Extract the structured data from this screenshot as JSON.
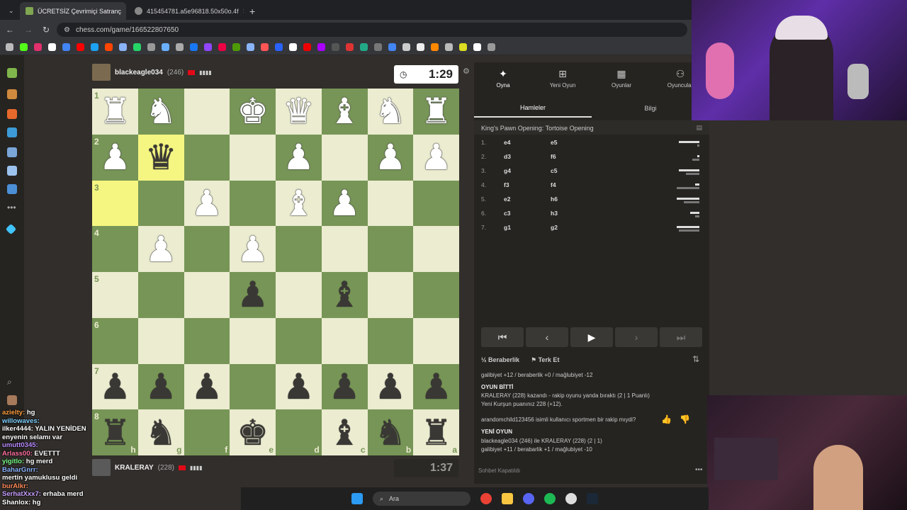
{
  "browser": {
    "tabs": [
      {
        "title": "ÜCRETSİZ Çevrimiçi Satranç",
        "active": true
      },
      {
        "title": "415454781.a5e96818.50x50o.4f",
        "active": false
      }
    ],
    "new_tab": "+",
    "url": "chess.com/game/166522807650"
  },
  "game": {
    "top_player": {
      "name": "blackeagle034",
      "rating": "(246)",
      "clock": "1:29"
    },
    "bottom_player": {
      "name": "KRALERAY",
      "rating": "(228)",
      "clock": "1:37"
    },
    "files": [
      "h",
      "g",
      "f",
      "e",
      "d",
      "c",
      "b",
      "a"
    ],
    "ranks": [
      "1",
      "2",
      "3",
      "4",
      "5",
      "6",
      "7",
      "8"
    ],
    "board": [
      [
        "wR",
        "wN",
        "",
        "wK",
        "wQ",
        "wB",
        "wN",
        "wR"
      ],
      [
        "wP",
        "bQ",
        "",
        "",
        "wP",
        "",
        "wP",
        "wP"
      ],
      [
        "",
        "",
        "wP",
        "",
        "wB",
        "wP",
        "",
        ""
      ],
      [
        "",
        "wP",
        "",
        "wP",
        "",
        "",
        "",
        ""
      ],
      [
        "",
        "",
        "",
        "bP",
        "",
        "bB",
        "",
        ""
      ],
      [
        "",
        "",
        "",
        "",
        "",
        "",
        "",
        ""
      ],
      [
        "bP",
        "bP",
        "bP",
        "",
        "bP",
        "bP",
        "bP",
        "bP"
      ],
      [
        "bR",
        "bN",
        "",
        "bK",
        "",
        "bB",
        "bN",
        "bR"
      ]
    ],
    "highlights": [
      [
        1,
        1
      ],
      [
        2,
        0
      ]
    ]
  },
  "panel": {
    "tabs": [
      "Oyna",
      "Yeni Oyun",
      "Oyunlar",
      "Oyuncular"
    ],
    "subtabs": [
      "Hamleler",
      "Bilgi"
    ],
    "opening": "King's Pawn Opening: Tortoise Opening",
    "moves": [
      {
        "n": "1.",
        "w": "e4",
        "b": "e5",
        "tw": 0.9,
        "tb": 0.1
      },
      {
        "n": "2.",
        "w": "d3",
        "b": "f6",
        "tw": 0.1,
        "tb": 0.3
      },
      {
        "n": "3.",
        "w": "g4",
        "b": "c5",
        "tw": 0.9,
        "tb": 0.6
      },
      {
        "n": "4.",
        "w": "f3",
        "b": "f4",
        "tw": 0.2,
        "tb": 1.0
      },
      {
        "n": "5.",
        "w": "e2",
        "b": "h6",
        "tw": 1.0,
        "tb": 0.7
      },
      {
        "n": "6.",
        "w": "c3",
        "b": "h3",
        "tw": 0.4,
        "tb": 0.2
      },
      {
        "n": "7.",
        "w": "g1",
        "b": "g2",
        "tw": 1.0,
        "tb": 0.9
      }
    ],
    "nav": [
      "⏮",
      "‹",
      "▶",
      "›",
      "⏭"
    ],
    "draw_label": "Beraberlik",
    "resign_label": "Terk Et",
    "results": {
      "line1": "galibiyet +12 / beraberlik +0 / mağlubiyet -12",
      "over_title": "OYUN BİTTİ",
      "over_desc": "KRALERAY (228) kazandı - rakip oyunu yanda bıraktı (2 | 1 Puanlı)",
      "rating_line": "Yeni Kurşun puanınız 228 (+12).",
      "question": "arandomchild123456 isimli kullanıcı sportmen bir rakip mıydi?",
      "new_game_title": "YENİ OYUN",
      "new_game_desc": "blackeagle034 (246) ile KRALERAY (228) (2 | 1)",
      "new_game_stats": "galibiyet +11 / berabarlik +1 / mağlubiyet -10"
    },
    "chat_closed": "Sohbet Kapatıldı"
  },
  "chat": [
    {
      "user": "azielty",
      "msg": "hg"
    },
    {
      "user": "willowaves",
      "msg": ""
    },
    {
      "user": "ilker4444",
      "msg": "YALIN YENİDEN"
    },
    {
      "user": "",
      "msg": "enyenin selamı var"
    },
    {
      "user": "umutt0345",
      "msg": ""
    },
    {
      "user": "Arlass00",
      "msg": "EVETTT"
    },
    {
      "user": "yigitlo",
      "msg": "hg merd"
    },
    {
      "user": "BaharGnrr",
      "msg": ""
    },
    {
      "user": "",
      "msg": "mertin yamuklusu geldi"
    },
    {
      "user": "burAlkr",
      "msg": ""
    },
    {
      "user": "SerhatXxx7",
      "msg": "erhaba merd"
    },
    {
      "user": "Shanlox",
      "msg": "hg"
    }
  ],
  "taskbar": {
    "search": "Ara"
  },
  "colors": {
    "light": "#ebecd0",
    "dark": "#779556",
    "panel": "#262421",
    "bg": "#312e2b"
  }
}
